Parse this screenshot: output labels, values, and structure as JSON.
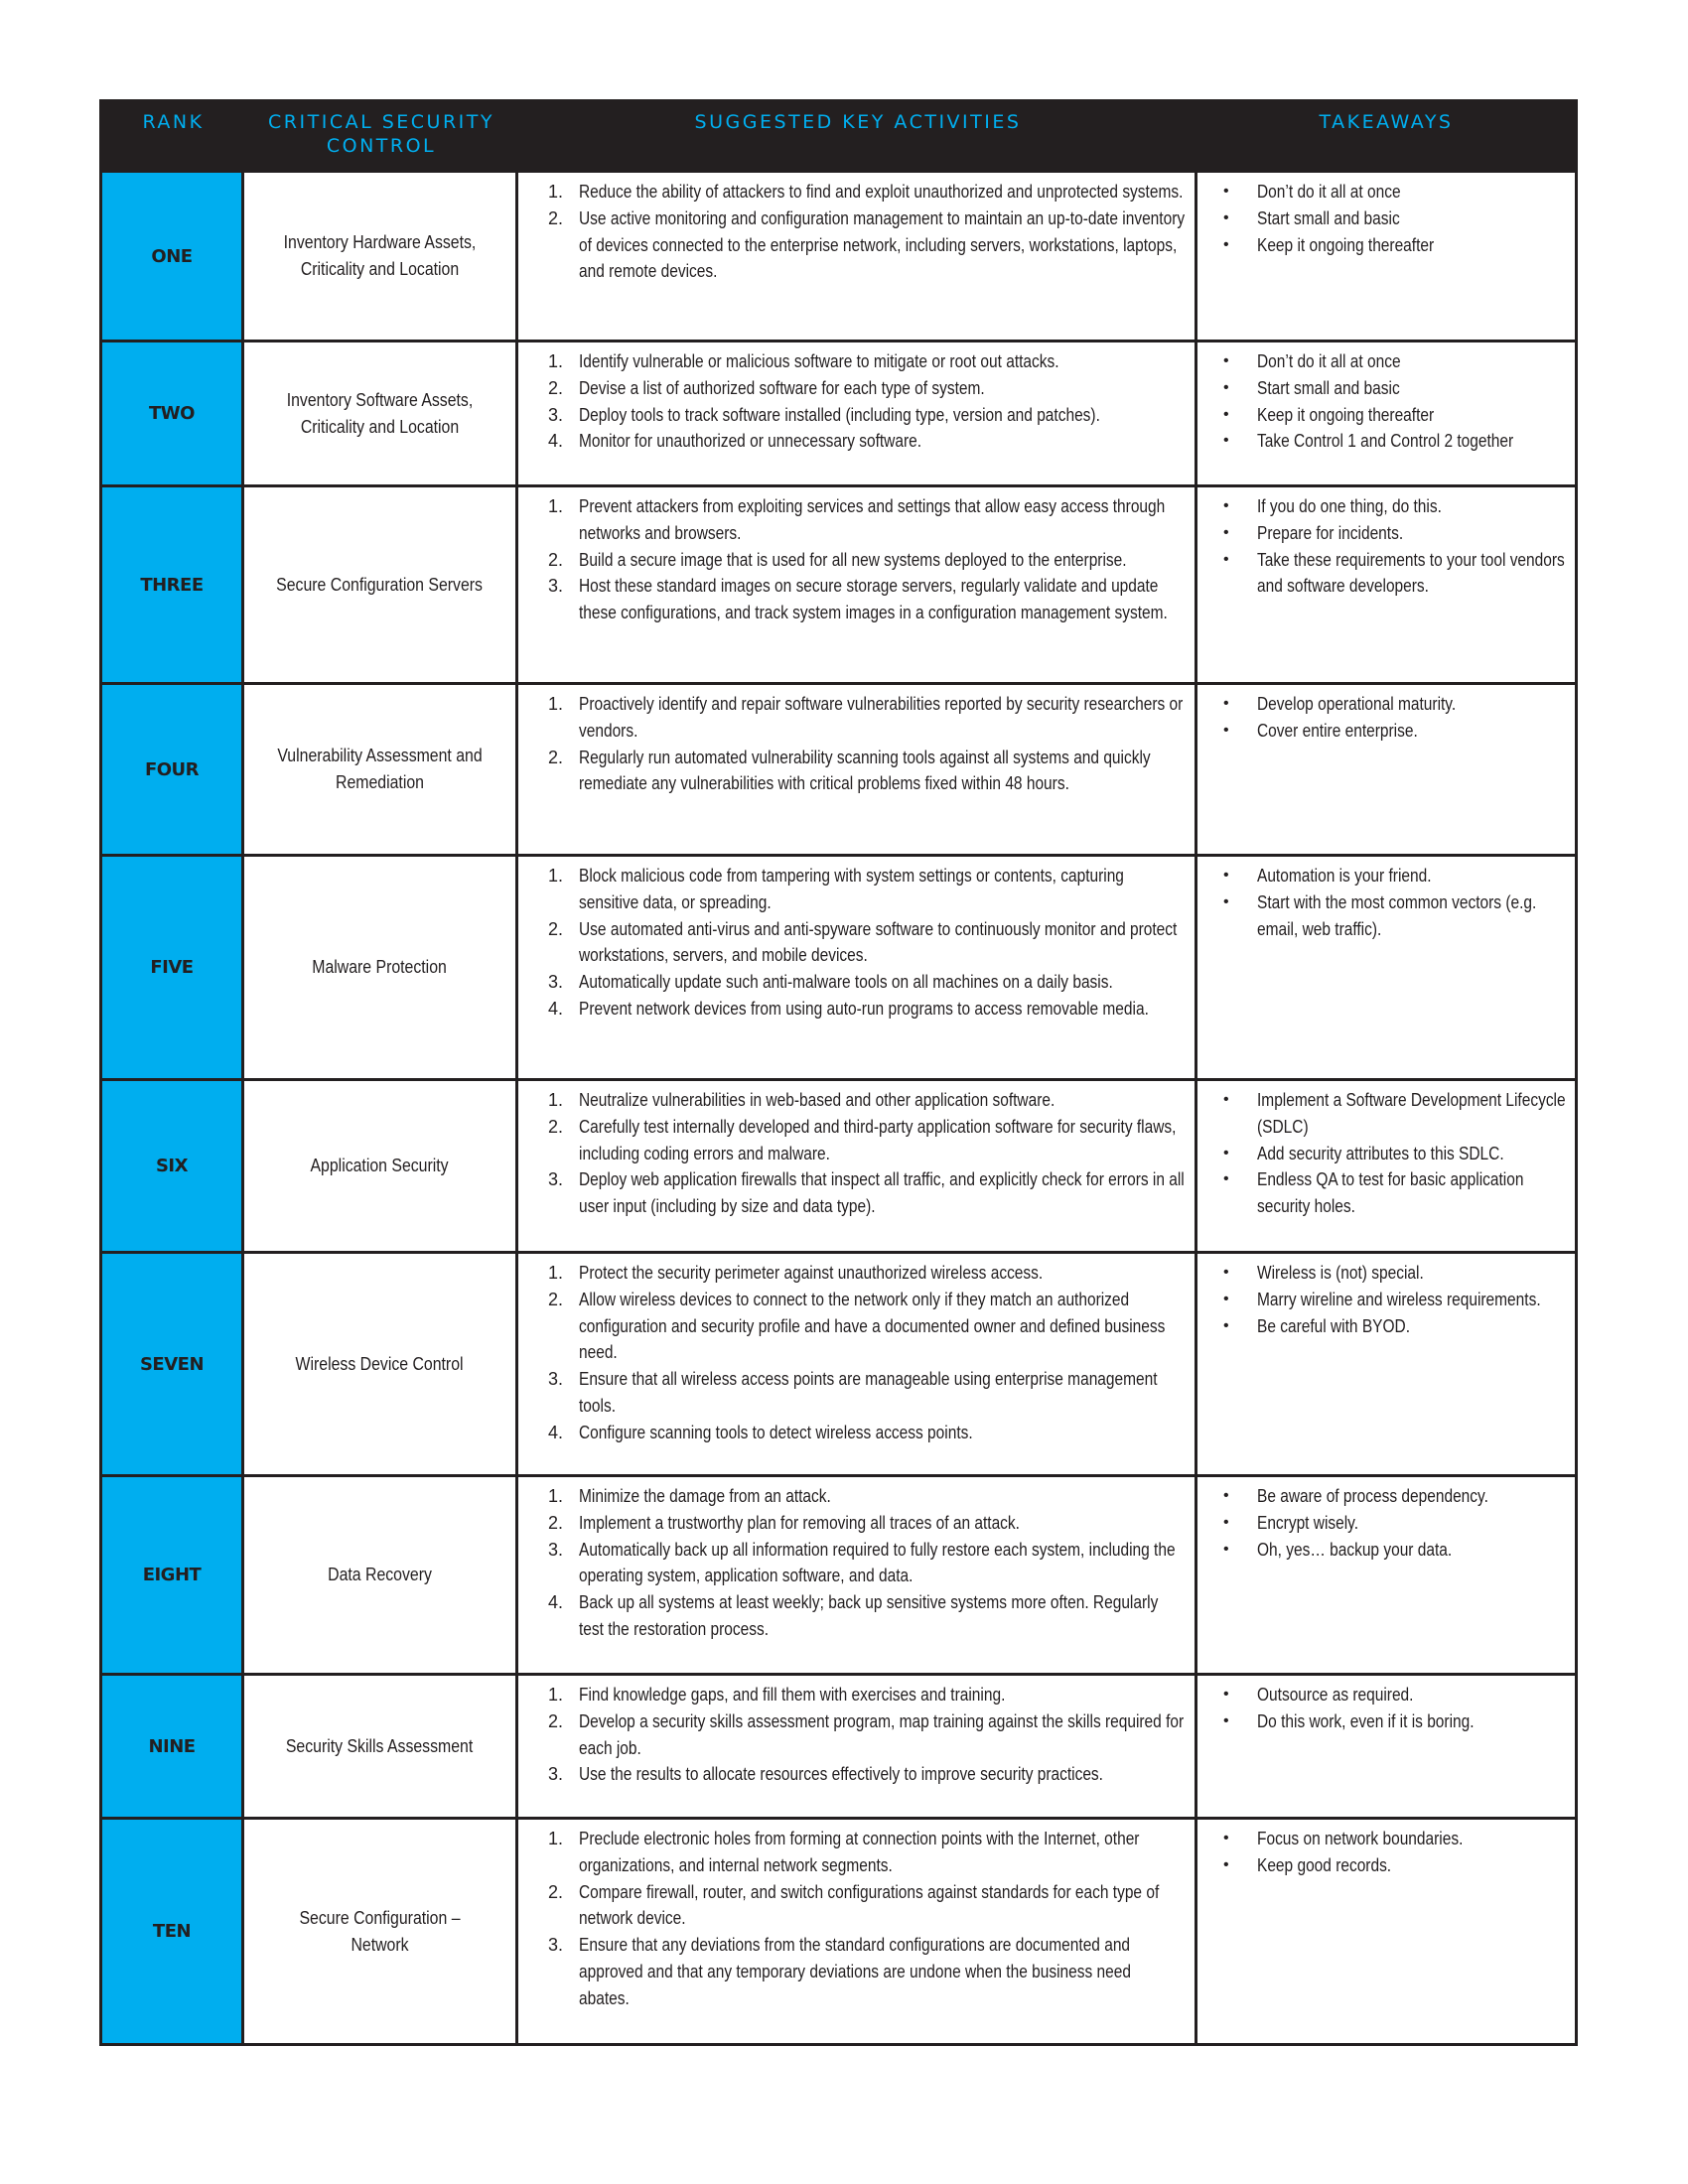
{
  "header": {
    "rank": "RANK",
    "control": "CRITICAL SECURITY CONTROL",
    "activities": "SUGGESTED KEY ACTIVITIES",
    "takeaways": "TAKEAWAYS"
  },
  "colors": {
    "accent": "#00aeef",
    "dark": "#231f20"
  },
  "rows": [
    {
      "rank": "ONE",
      "control": "Inventory Hardware Assets, Criticality and Location",
      "activities": [
        "Reduce the ability of attackers to find and exploit unauthorized and unprotected systems.",
        "Use active monitoring and configuration management to maintain an up-to-date inventory of devices connected to the enterprise network, including servers, workstations, laptops, and remote devices."
      ],
      "takeaways": [
        "Don’t do it all at once",
        "Start small and basic",
        "Keep it ongoing thereafter"
      ]
    },
    {
      "rank": "TWO",
      "control": "Inventory Software Assets, Criticality and Location",
      "activities": [
        "Identify vulnerable or malicious software to mitigate or root out attacks.",
        "Devise a list of authorized software for each type of system.",
        "Deploy tools to track software installed (including type, version and patches).",
        "Monitor for unauthorized or unnecessary software."
      ],
      "takeaways": [
        "Don’t do it all at once",
        "Start small and basic",
        "Keep it ongoing thereafter",
        "Take Control 1 and Control 2 together"
      ]
    },
    {
      "rank": "THREE",
      "control": "Secure Configuration Servers",
      "activities": [
        "Prevent attackers from exploiting services and settings that allow easy access through networks and browsers.",
        "Build a secure image that is used for all new systems deployed to the enterprise.",
        "Host these standard images on secure storage servers, regularly validate and update these configurations, and track system images in a configuration management system."
      ],
      "takeaways": [
        "If you do one thing, do this.",
        "Prepare for incidents.",
        "Take these requirements to your tool vendors and software developers."
      ]
    },
    {
      "rank": "FOUR",
      "control": "Vulnerability Assessment and Remediation",
      "activities": [
        "Proactively identify and repair software vulnerabilities reported by security researchers or vendors.",
        "Regularly run automated vulnerability scanning tools against all systems and quickly remediate any vulnerabilities with critical problems fixed within 48 hours."
      ],
      "takeaways": [
        "Develop operational maturity.",
        "Cover entire enterprise."
      ]
    },
    {
      "rank": "FIVE",
      "control": "Malware Protection",
      "activities": [
        "Block malicious code from tampering with system settings or contents, capturing sensitive data, or spreading.",
        "Use automated anti-virus and anti-spyware software to continuously monitor and protect workstations, servers, and mobile devices.",
        "Automatically update such anti-malware tools on all machines on a daily basis.",
        "Prevent network devices from using auto-run programs to access removable media."
      ],
      "takeaways": [
        "Automation is your friend.",
        "Start with the most common vectors (e.g. email, web traffic)."
      ]
    },
    {
      "rank": "SIX",
      "control": "Application Security",
      "activities": [
        "Neutralize vulnerabilities in web-based and other application software.",
        "Carefully test internally developed and third-party application software for security flaws, including coding errors and malware.",
        "Deploy web application firewalls that inspect all traffic, and explicitly check for errors in all user input (including by size and data type)."
      ],
      "takeaways": [
        "Implement a Software Development Lifecycle (SDLC)",
        "Add security attributes to this SDLC.",
        "Endless QA to test for basic application security holes."
      ]
    },
    {
      "rank": "SEVEN",
      "control": "Wireless Device Control",
      "activities": [
        "Protect the security perimeter against unauthorized wireless access.",
        "Allow wireless devices to connect to the network only if they match an authorized configuration and security profile and have a documented owner and defined business need.",
        "Ensure that all wireless access points are manageable using enterprise management tools.",
        "Configure scanning tools to detect wireless access points."
      ],
      "takeaways": [
        "Wireless is (not) special.",
        "Marry wireline and wireless requirements.",
        "Be careful with BYOD."
      ]
    },
    {
      "rank": "EIGHT",
      "control": "Data Recovery",
      "activities": [
        "Minimize the damage from an attack.",
        "Implement a trustworthy plan for removing all traces of an attack.",
        "Automatically back up all information required to fully restore each system, including the operating system, application software, and data.",
        "Back up all systems at least weekly; back up sensitive systems more often. Regularly test the restoration process."
      ],
      "takeaways": [
        "Be aware of process dependency.",
        "Encrypt wisely.",
        "Oh, yes… backup your data."
      ]
    },
    {
      "rank": "NINE",
      "control": "Security Skills Assessment",
      "activities": [
        "Find knowledge gaps, and fill them with exercises and training.",
        "Develop a security skills assessment program, map training against the skills required for each job.",
        "Use the results to allocate resources effectively to improve security practices."
      ],
      "takeaways": [
        "Outsource as required.",
        "Do this work, even if it is boring."
      ]
    },
    {
      "rank": "TEN",
      "control": "Secure Configuration – Network",
      "activities": [
        "Preclude electronic holes from forming at connection points with the Internet, other organizations, and internal network segments.",
        "Compare firewall, router, and switch configurations against standards for each type of network device.",
        "Ensure that any deviations from the standard configurations are documented and approved and that any temporary deviations are undone when the business need abates."
      ],
      "takeaways": [
        "Focus on network boundaries.",
        "Keep good records."
      ]
    }
  ]
}
